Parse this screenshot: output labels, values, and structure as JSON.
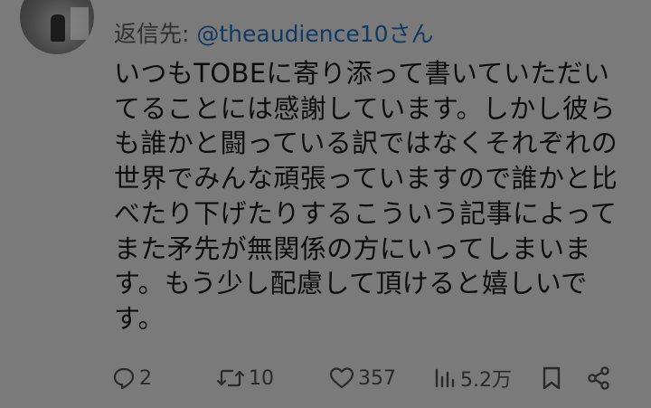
{
  "tweet": {
    "reply_prefix": "返信先: ",
    "reply_handle": "@theaudience10さん",
    "body": "いつもTOBEに寄り添って書いていただいてることには感謝しています。しかし彼らも誰かと闘っている訳ではなくそれぞれの世界でみんな頑張っていますので誰かと比べたり下げたりするこういう記事によってまた矛先が無関係の方にいってしまいます。もう少し配慮して頂けると嬉しいです。"
  },
  "actions": {
    "reply": {
      "icon": "reply-icon",
      "count": "2"
    },
    "retweet": {
      "icon": "retweet-icon",
      "count": "10"
    },
    "like": {
      "icon": "heart-icon",
      "count": "357"
    },
    "views": {
      "icon": "views-icon",
      "count": "5.2万"
    },
    "bookmark": {
      "icon": "bookmark-icon"
    },
    "share": {
      "icon": "share-icon"
    }
  },
  "colors": {
    "background": "#7a7a7a",
    "text": "#111111",
    "link": "#0f3a63"
  }
}
